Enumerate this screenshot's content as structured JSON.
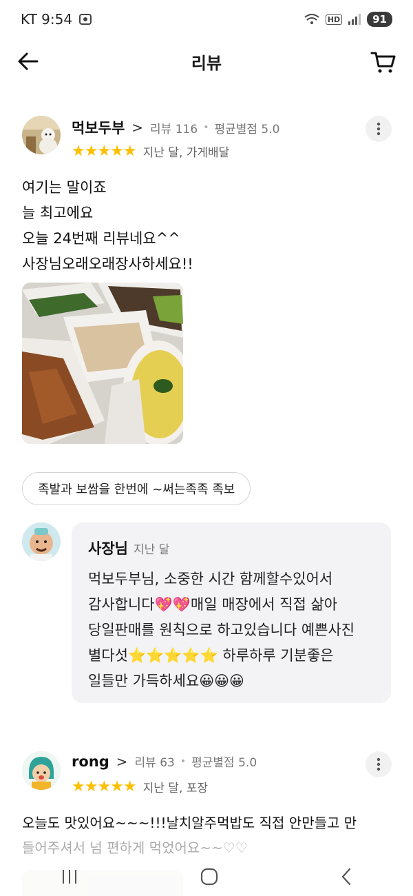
{
  "status_bar": {
    "carrier_time": "KT 9:54",
    "hd": "HD",
    "battery": "91"
  },
  "header": {
    "title": "리뷰"
  },
  "reviews": [
    {
      "name": "먹보두부",
      "review_count": "리뷰 116",
      "avg_rating": "평균별점 5.0",
      "stars": "★★★★★",
      "rating": 5,
      "time_type": "지난 달, 가게배달",
      "text_lines": [
        "여기는 말이죠",
        "늘 최고에요",
        "오늘 24번째 리뷰네요^^",
        "사장님오래오래장사하세요!!"
      ],
      "menu_tag": "족발과 보쌈을 한번에 ~써는족족 족보",
      "owner_reply": {
        "name": "사장님",
        "time": "지난 달",
        "lines": [
          "먹보두부님, 소중한 시간 함께할수있어서",
          "감사합니다💖💖매일 매장에서 직접 삶아",
          "당일판매를 원칙으로 하고있습니다 예쁜사진",
          "별다섯⭐⭐⭐⭐⭐ 하루하루 기분좋은",
          "일들만 가득하세요😀😀😀"
        ]
      }
    },
    {
      "name": "rong",
      "review_count": "리뷰 63",
      "avg_rating": "평균별점 5.0",
      "stars": "★★★★★",
      "rating": 5,
      "time_type": "지난 달, 포장",
      "text_lines": [
        "오늘도 맛있어요~~~!!!날치알주먹밥도 직접 안만들고 만",
        "들어주셔서 넘 편하게 먹었어요~~♡♡"
      ]
    }
  ],
  "icons": {
    "back": "back-arrow-icon",
    "cart": "cart-icon",
    "more": "more-vertical-icon",
    "nav_recent": "recent-apps-icon",
    "nav_home": "home-icon",
    "nav_back": "nav-back-icon"
  },
  "colors": {
    "star": "#ffbf00",
    "bubble_bg": "#f3f3f5"
  }
}
